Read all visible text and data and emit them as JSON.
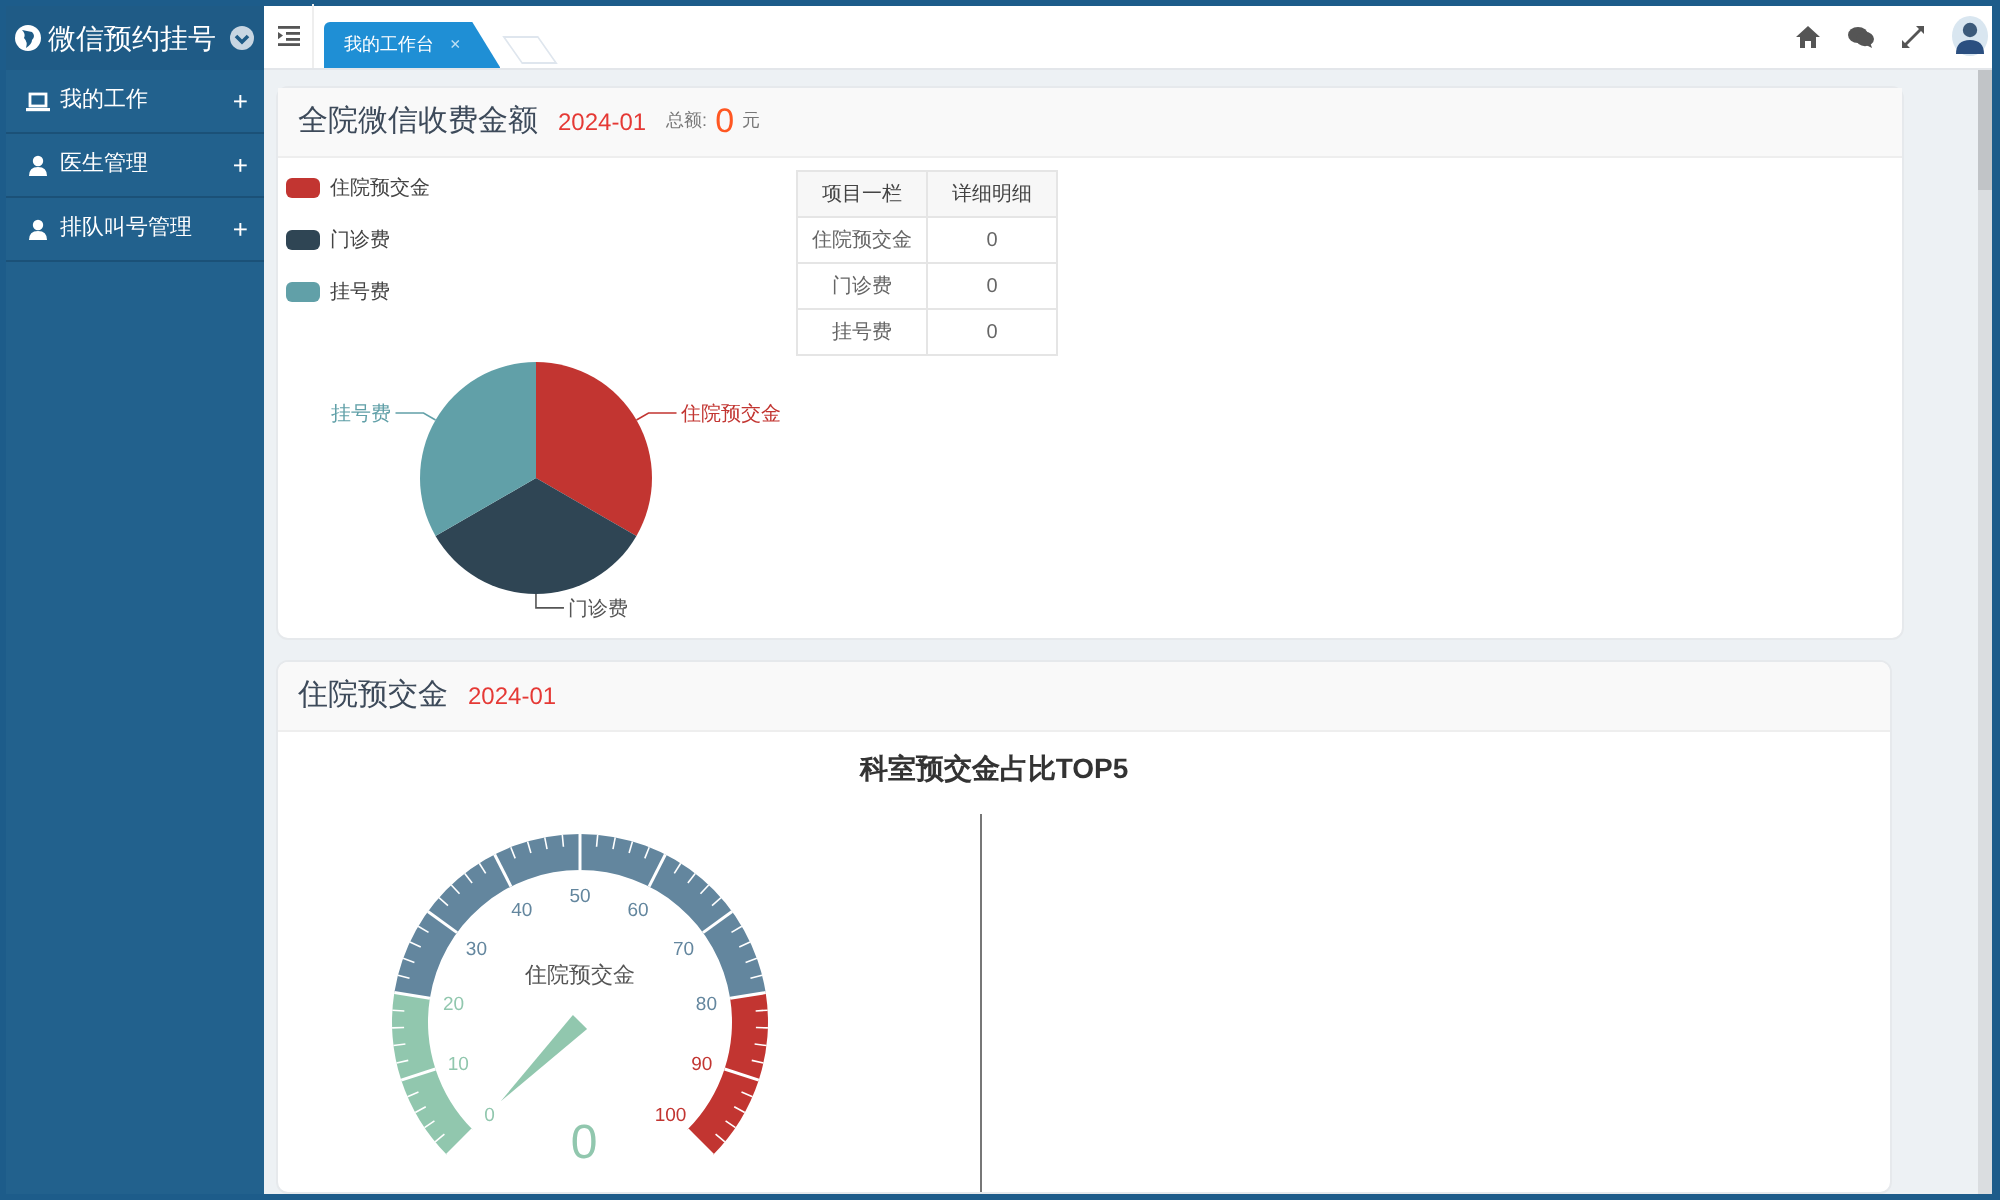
{
  "sidebar": {
    "brand": "微信预约挂号",
    "items": [
      {
        "label": "我的工作",
        "kind": "laptop",
        "expander": "+"
      },
      {
        "label": "医生管理",
        "kind": "user",
        "expander": "+"
      },
      {
        "label": "排队叫号管理",
        "kind": "user",
        "expander": "+"
      }
    ]
  },
  "tabs": [
    {
      "label": "我的工作台",
      "close": "×",
      "selected": true
    }
  ],
  "revenue_card": {
    "title": "全院微信收费金额",
    "period": "2024-01",
    "total_label": "总额:",
    "total": "0",
    "unit": "元",
    "legend": [
      {
        "label": "住院预交金",
        "color": "#c23531"
      },
      {
        "label": "门诊费",
        "color": "#2f4554"
      },
      {
        "label": "挂号费",
        "color": "#61a0a8"
      }
    ],
    "chart_data": {
      "type": "pie",
      "categories": [
        "住院预交金",
        "门诊费",
        "挂号费"
      ],
      "values": [
        33.34,
        33.33,
        33.33
      ]
    },
    "table": {
      "columns": [
        "项目一栏",
        "详细明细"
      ],
      "rows": [
        [
          "住院预交金",
          "0"
        ],
        [
          "门诊费",
          "0"
        ],
        [
          "挂号费",
          "0"
        ]
      ]
    }
  },
  "deposit_card": {
    "title": "住院预交金",
    "period": "2024-01",
    "gauge": {
      "title": "住院预交金",
      "value": "0",
      "ticks": [
        "0",
        "10",
        "20",
        "30",
        "40",
        "50",
        "60",
        "70",
        "80",
        "90",
        "100"
      ],
      "bands": [
        {
          "color": "#91c7ae"
        },
        {
          "color": "#63869e"
        },
        {
          "color": "#c23531"
        }
      ]
    },
    "ranking_chart": {
      "title": "科室预交金占比TOP5"
    }
  }
}
